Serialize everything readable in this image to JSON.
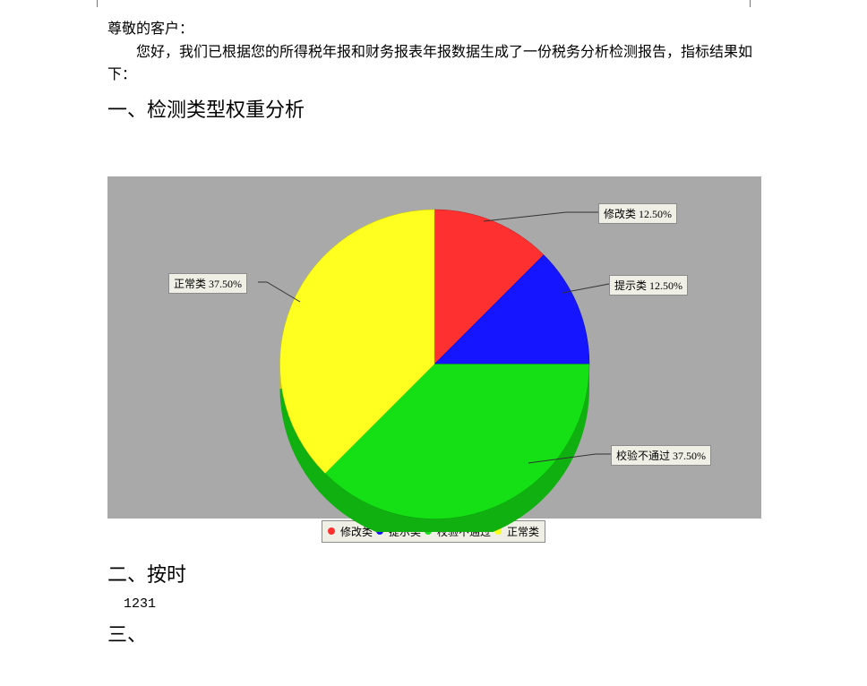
{
  "greeting_line": "尊敬的客户：",
  "intro_line": "您好，我们已根据您的所得税年报和财务报表年报数据生成了一份税务分析检测报告，指标结果如下：",
  "section1_heading": "一、检测类型权重分析",
  "section2_heading": "二、按时",
  "section2_body": "1231",
  "section3_heading": "三、",
  "chart_data": {
    "type": "pie",
    "title": "",
    "series": [
      {
        "name": "修改类",
        "value": 12.5,
        "label": "修改类 12.50%",
        "color": "#ff3030"
      },
      {
        "name": "提示类",
        "value": 12.5,
        "label": "提示类 12.50%",
        "color": "#1515ff"
      },
      {
        "name": "校验不通过",
        "value": 37.5,
        "label": "校验不通过 37.50%",
        "color": "#15e015"
      },
      {
        "name": "正常类",
        "value": 37.5,
        "label": "正常类 37.50%",
        "color": "#ffff20"
      }
    ],
    "legend": [
      "修改类",
      "提示类",
      "校验不通过",
      "正常类"
    ]
  }
}
